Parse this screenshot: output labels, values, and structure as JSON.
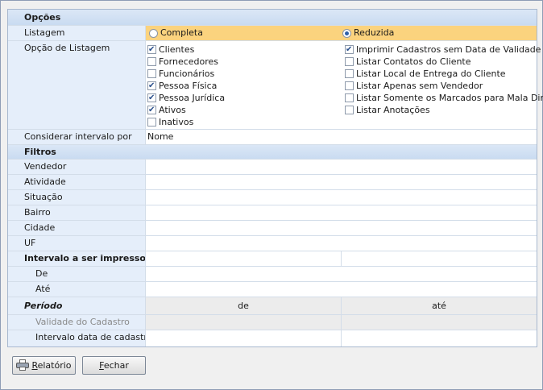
{
  "sections": {
    "opcoes": "Opções",
    "filtros": "Filtros"
  },
  "listagem": {
    "label": "Listagem",
    "options": [
      {
        "label": "Completa",
        "selected": false
      },
      {
        "label": "Reduzida",
        "selected": true
      }
    ]
  },
  "opcao_listagem": {
    "label": "Opção de Listagem",
    "left": [
      {
        "label": "Clientes",
        "checked": true
      },
      {
        "label": "Fornecedores",
        "checked": false
      },
      {
        "label": "Funcionários",
        "checked": false
      },
      {
        "label": "Pessoa Física",
        "checked": true
      },
      {
        "label": "Pessoa Jurídica",
        "checked": true
      },
      {
        "label": "Ativos",
        "checked": true
      },
      {
        "label": "Inativos",
        "checked": false
      }
    ],
    "right": [
      {
        "label": "Imprimir Cadastros sem Data de Validade",
        "checked": true
      },
      {
        "label": "Listar Contatos do Cliente",
        "checked": false
      },
      {
        "label": "Listar Local de Entrega do Cliente",
        "checked": false
      },
      {
        "label": "Listar Apenas sem Vendedor",
        "checked": false
      },
      {
        "label": "Listar Somente os Marcados para Mala Direta",
        "checked": false
      },
      {
        "label": "Listar Anotações",
        "checked": false
      }
    ]
  },
  "considerar": {
    "label": "Considerar intervalo por",
    "value": "Nome"
  },
  "filtros": {
    "vendedor": "Vendedor",
    "atividade": "Atividade",
    "situacao": "Situação",
    "bairro": "Bairro",
    "cidade": "Cidade",
    "uf": "UF"
  },
  "intervalo": {
    "label": "Intervalo a ser impresso",
    "de": "De",
    "ate": "Até"
  },
  "periodo": {
    "label": "Período",
    "col_de": "de",
    "col_ate": "até",
    "validade": "Validade do Cadastro",
    "intervalo_data": "Intervalo data de cadastro"
  },
  "buttons": {
    "relatorio_accel": "R",
    "relatorio_rest": "elatório",
    "fechar_accel": "F",
    "fechar_rest": "echar"
  }
}
